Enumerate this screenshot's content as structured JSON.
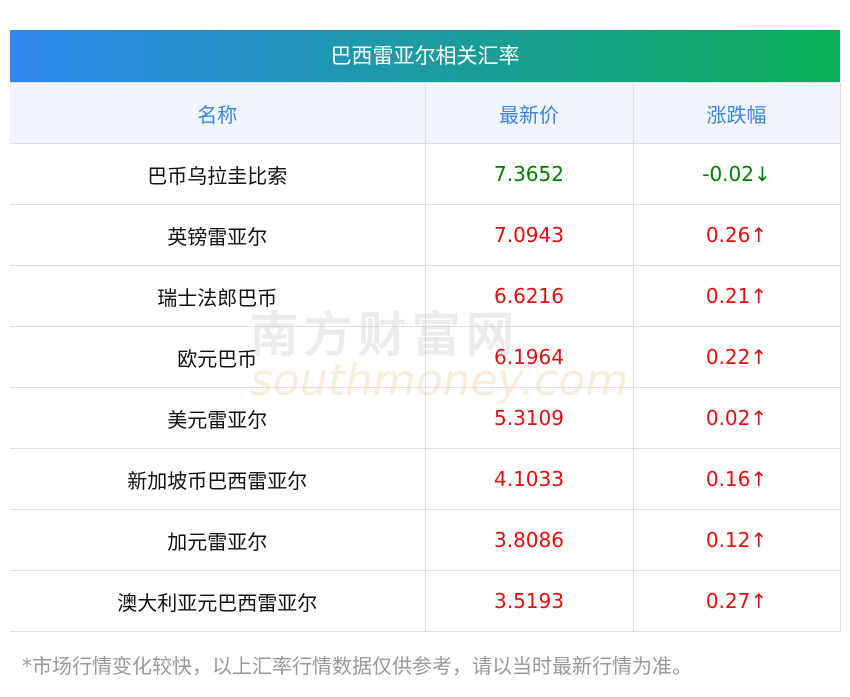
{
  "title": "巴西雷亚尔相关汇率",
  "headers": [
    "名称",
    "最新价",
    "涨跌幅"
  ],
  "rows": [
    {
      "name": "巴币乌拉圭比索",
      "price": "7.3652",
      "change": "-0.02↓",
      "dir": "down"
    },
    {
      "name": "英镑雷亚尔",
      "price": "7.0943",
      "change": "0.26↑",
      "dir": "up"
    },
    {
      "name": "瑞士法郎巴币",
      "price": "6.6216",
      "change": "0.21↑",
      "dir": "up"
    },
    {
      "name": "欧元巴币",
      "price": "6.1964",
      "change": "0.22↑",
      "dir": "up"
    },
    {
      "name": "美元雷亚尔",
      "price": "5.3109",
      "change": "0.02↑",
      "dir": "up"
    },
    {
      "name": "新加坡币巴西雷亚尔",
      "price": "4.1033",
      "change": "0.16↑",
      "dir": "up"
    },
    {
      "name": "加元雷亚尔",
      "price": "3.8086",
      "change": "0.12↑",
      "dir": "up"
    },
    {
      "name": "澳大利亚元巴西雷亚尔",
      "price": "3.5193",
      "change": "0.27↑",
      "dir": "up"
    }
  ],
  "watermark": {
    "cn": "南方财富网",
    "en": "southmoney.com"
  },
  "note": "*市场行情变化较快，以上汇率行情数据仅供参考，请以当时最新行情为准。"
}
